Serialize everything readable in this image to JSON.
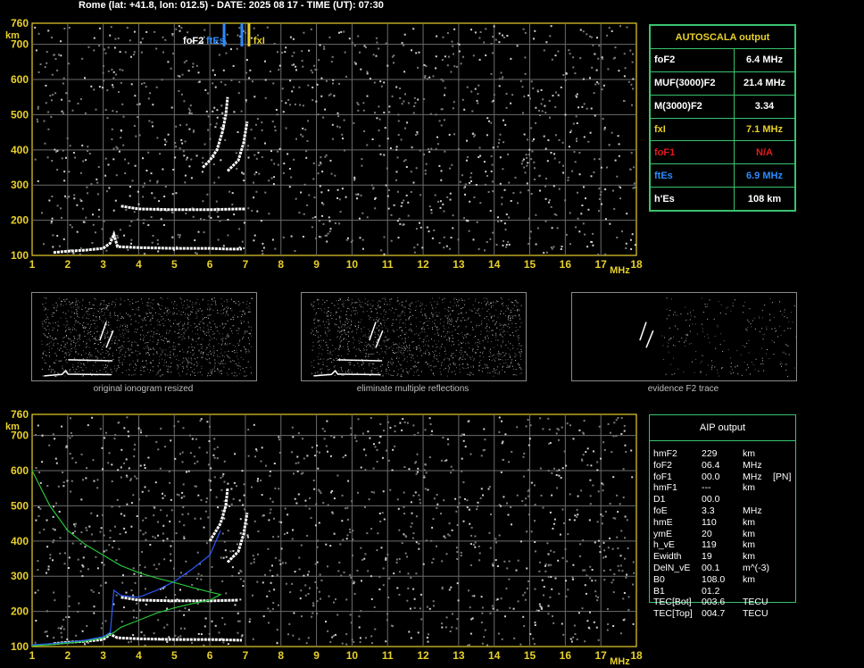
{
  "header": {
    "title": "Rome (lat: +41.8, lon: 012.5) - DATE: 2025 08 17 - TIME (UT): 07:30"
  },
  "autoscala": {
    "title": "AUTOSCALA output",
    "rows": [
      {
        "label": "foF2",
        "value": "6.4 MHz",
        "color": "#ffffff"
      },
      {
        "label": "MUF(3000)F2",
        "value": "21.4 MHz",
        "color": "#ffffff"
      },
      {
        "label": "M(3000)F2",
        "value": "3.34",
        "color": "#ffffff"
      },
      {
        "label": "fxI",
        "value": "7.1 MHz",
        "color": "#e8d02a"
      },
      {
        "label": "foF1",
        "value": "N/A",
        "color": "#e31a1a"
      },
      {
        "label": "ftEs",
        "value": "6.9 MHz",
        "color": "#2a8cff"
      },
      {
        "label": "h'Es",
        "value": "108    km",
        "color": "#ffffff"
      }
    ]
  },
  "markers": {
    "foF2_label": "foF2",
    "ftEs_label": "ftEs",
    "fxI_label": "fxI"
  },
  "thumbnails": {
    "captions": [
      "original ionogram resized",
      "eliminate multiple reflections",
      "evidence F2 trace"
    ]
  },
  "aip": {
    "title": "AIP output",
    "rows": [
      {
        "name": "hmF2",
        "value": "229",
        "unit": "km",
        "extra": ""
      },
      {
        "name": "foF2",
        "value": "06.4",
        "unit": "MHz",
        "extra": ""
      },
      {
        "name": "foF1",
        "value": "00.0",
        "unit": "MHz",
        "extra": "[PN]"
      },
      {
        "name": "hmF1",
        "value": "---",
        "unit": "km",
        "extra": ""
      },
      {
        "name": "D1",
        "value": "00.0",
        "unit": "",
        "extra": ""
      },
      {
        "name": "foE",
        "value": "3.3",
        "unit": "MHz",
        "extra": ""
      },
      {
        "name": "hmE",
        "value": "110",
        "unit": "km",
        "extra": ""
      },
      {
        "name": "ymE",
        "value": "20",
        "unit": "km",
        "extra": ""
      },
      {
        "name": "h_vE",
        "value": "119",
        "unit": "km",
        "extra": ""
      },
      {
        "name": "Ewidth",
        "value": "19",
        "unit": "km",
        "extra": ""
      },
      {
        "name": "DelN_vE",
        "value": "00.1",
        "unit": "m^(-3)",
        "extra": ""
      },
      {
        "name": "B0",
        "value": "108.0",
        "unit": "km",
        "extra": ""
      },
      {
        "name": "B1",
        "value": "01.2",
        "unit": "",
        "extra": ""
      },
      {
        "name": "TEC[Bot]",
        "value": "003.6",
        "unit": "TECU",
        "extra": ""
      },
      {
        "name": "TEC[Top]",
        "value": "004.7",
        "unit": "TECU",
        "extra": ""
      }
    ]
  },
  "chart_data": [
    {
      "type": "scatter",
      "title": "",
      "xlabel": "MHz",
      "ylabel": "km",
      "xlim": [
        1,
        18
      ],
      "ylim": [
        100,
        760
      ],
      "xticks": [
        "1",
        "2",
        "3",
        "4",
        "5",
        "6",
        "7",
        "8",
        "9",
        "10",
        "11",
        "12",
        "13",
        "14",
        "15",
        "16",
        "17",
        "18"
      ],
      "yticks": [
        "100",
        "200",
        "300",
        "400",
        "500",
        "600",
        "700",
        "760"
      ],
      "grid": true,
      "markers": [
        {
          "name": "foF2",
          "x": 6.4,
          "color": "#2a8cff"
        },
        {
          "name": "ftEs",
          "x": 6.9,
          "color": "#2a8cff"
        },
        {
          "name": "fxI",
          "x": 7.1,
          "color": "#e8d02a"
        }
      ],
      "series": [
        {
          "color": "#ffffff",
          "points": [
            [
              1.6,
              108
            ],
            [
              2.0,
              112
            ],
            [
              2.5,
              115
            ],
            [
              3.0,
              120
            ],
            [
              3.2,
              135
            ],
            [
              3.3,
              160
            ],
            [
              3.4,
              125
            ],
            [
              4.0,
              122
            ],
            [
              5.0,
              120
            ],
            [
              6.0,
              120
            ],
            [
              6.5,
              118
            ],
            [
              6.9,
              118
            ]
          ]
        },
        {
          "color": "#ffffff",
          "points": [
            [
              3.5,
              240
            ],
            [
              4.0,
              232
            ],
            [
              5.0,
              230
            ],
            [
              6.0,
              230
            ],
            [
              6.8,
              232
            ],
            [
              7.0,
              232
            ]
          ]
        },
        {
          "color": "#ffffff",
          "points": [
            [
              5.8,
              350
            ],
            [
              6.0,
              370
            ],
            [
              6.2,
              400
            ],
            [
              6.35,
              450
            ],
            [
              6.45,
              500
            ],
            [
              6.5,
              550
            ]
          ]
        },
        {
          "color": "#ffffff",
          "points": [
            [
              6.5,
              340
            ],
            [
              6.8,
              370
            ],
            [
              6.95,
              420
            ],
            [
              7.05,
              480
            ]
          ]
        }
      ]
    },
    {
      "type": "scatter",
      "title": "",
      "xlabel": "MHz",
      "ylabel": "km",
      "xlim": [
        1,
        18
      ],
      "ylim": [
        100,
        760
      ],
      "xticks": [
        "1",
        "2",
        "3",
        "4",
        "5",
        "6",
        "7",
        "8",
        "9",
        "10",
        "11",
        "12",
        "13",
        "14",
        "15",
        "16",
        "17",
        "18"
      ],
      "yticks": [
        "100",
        "200",
        "300",
        "400",
        "500",
        "600",
        "700",
        "760"
      ],
      "grid": true,
      "series": [
        {
          "color": "#ffffff",
          "points": [
            [
              1.6,
              108
            ],
            [
              2.0,
              112
            ],
            [
              2.5,
              115
            ],
            [
              3.0,
              120
            ],
            [
              3.2,
              135
            ],
            [
              3.4,
              125
            ],
            [
              4.0,
              122
            ],
            [
              5.0,
              120
            ],
            [
              6.0,
              120
            ],
            [
              6.9,
              118
            ]
          ]
        },
        {
          "color": "#ffffff",
          "points": [
            [
              3.5,
              240
            ],
            [
              4.0,
              232
            ],
            [
              5.0,
              230
            ],
            [
              6.0,
              230
            ],
            [
              6.8,
              232
            ]
          ]
        },
        {
          "color": "#ffffff",
          "points": [
            [
              6.0,
              400
            ],
            [
              6.3,
              450
            ],
            [
              6.45,
              500
            ],
            [
              6.5,
              550
            ]
          ]
        },
        {
          "color": "#ffffff",
          "points": [
            [
              6.5,
              340
            ],
            [
              6.8,
              370
            ],
            [
              6.95,
              420
            ],
            [
              7.05,
              480
            ]
          ]
        },
        {
          "color": "#2a5bff",
          "points": [
            [
              1.0,
              105
            ],
            [
              1.5,
              108
            ],
            [
              2.0,
              112
            ],
            [
              2.5,
              118
            ],
            [
              3.0,
              128
            ],
            [
              3.2,
              140
            ],
            [
              3.3,
              260
            ],
            [
              3.5,
              245
            ],
            [
              4.0,
              240
            ],
            [
              4.5,
              260
            ],
            [
              5.0,
              285
            ],
            [
              5.5,
              320
            ],
            [
              6.0,
              360
            ],
            [
              6.3,
              430
            ]
          ]
        },
        {
          "color": "#27c43a",
          "points": [
            [
              1.0,
              600
            ],
            [
              1.5,
              500
            ],
            [
              2.0,
              430
            ],
            [
              2.5,
              390
            ],
            [
              3.0,
              360
            ],
            [
              3.5,
              330
            ],
            [
              4.0,
              310
            ],
            [
              4.5,
              295
            ],
            [
              5.0,
              282
            ],
            [
              5.5,
              268
            ],
            [
              6.0,
              255
            ],
            [
              6.3,
              248
            ],
            [
              6.0,
              232
            ],
            [
              5.5,
              222
            ],
            [
              5.0,
              210
            ],
            [
              4.5,
              195
            ],
            [
              4.0,
              175
            ],
            [
              3.5,
              155
            ],
            [
              3.3,
              140
            ],
            [
              3.0,
              125
            ],
            [
              2.5,
              115
            ],
            [
              2.0,
              110
            ],
            [
              1.5,
              105
            ],
            [
              1.0,
              102
            ]
          ]
        }
      ]
    }
  ]
}
